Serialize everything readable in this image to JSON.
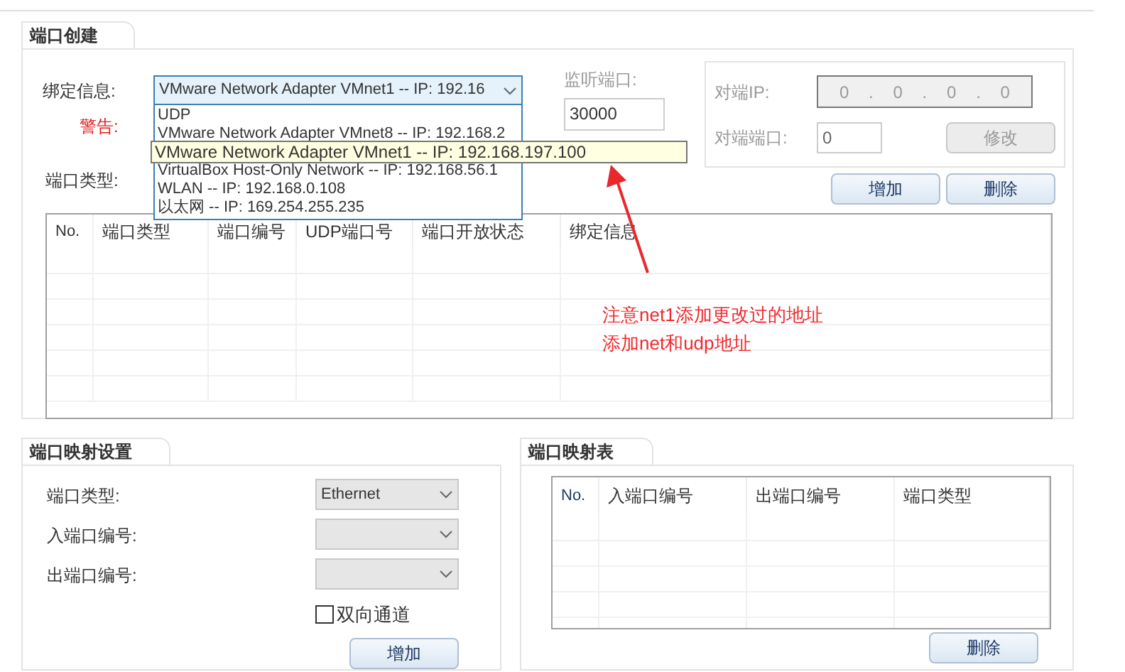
{
  "port_creation": {
    "title": "端口创建",
    "bind_label": "绑定信息:",
    "bind_value": "VMware Network Adapter VMnet1 -- IP: 192.16",
    "warning_label": "警告:",
    "port_type_label": "端口类型:",
    "dropdown_options": [
      {
        "label": "UDP",
        "hovered": false
      },
      {
        "label": "VMware Network Adapter VMnet8 -- IP: 192.168.2",
        "hovered": false
      },
      {
        "label": "VMware Network Adapter VMnet1 -- IP: 192.168.197.100",
        "hovered": true
      },
      {
        "label": "VirtualBox Host-Only Network -- IP: 192.168.56.1",
        "hovered": false
      },
      {
        "label": "WLAN -- IP: 192.168.0.108",
        "hovered": false
      },
      {
        "label": "以太网 -- IP: 169.254.255.235",
        "hovered": false
      }
    ],
    "listen_port": {
      "label": "监听端口:",
      "value": "30000",
      "disabled": true
    },
    "peer": {
      "disabled": true,
      "ip_label": "对端IP:",
      "ip_octets": [
        "0",
        "0",
        "0",
        "0"
      ],
      "separator": ".",
      "port_label": "对端端口:",
      "port_value": "0",
      "modify_button": "修改"
    },
    "add_button": "增加",
    "delete_button": "删除",
    "table": {
      "columns": [
        "No.",
        "端口类型",
        "端口编号",
        "UDP端口号",
        "端口开放状态",
        "绑定信息"
      ]
    }
  },
  "annotation": {
    "lines": [
      "注意net1添加更改过的地址",
      "添加net和udp地址"
    ]
  },
  "mapping_settings": {
    "title": "端口映射设置",
    "fields": [
      {
        "label": "端口类型:",
        "value": "Ethernet"
      },
      {
        "label": "入端口编号:"
      },
      {
        "label": "出端口编号:"
      }
    ],
    "bidirectional": {
      "label": "双向通道",
      "checked": false
    },
    "add_button": "增加"
  },
  "mapping_table": {
    "title": "端口映射表",
    "columns": [
      "No.",
      "入端口编号",
      "出端口编号",
      "端口类型"
    ],
    "delete_button": "删除"
  }
}
